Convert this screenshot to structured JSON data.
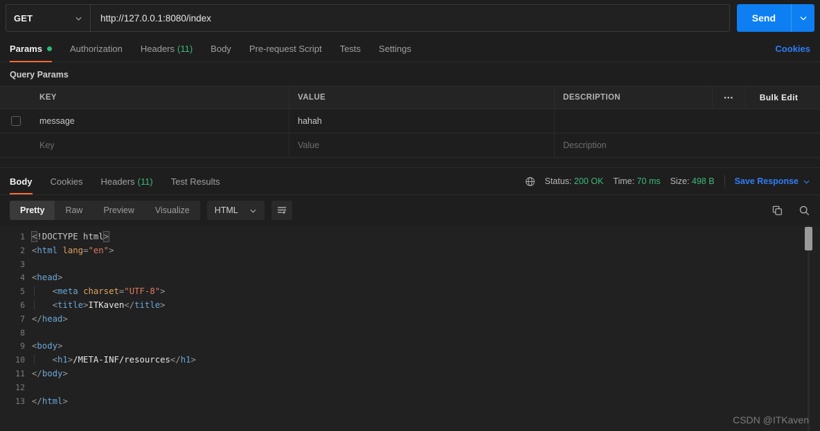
{
  "request": {
    "method": "GET",
    "url": "http://127.0.0.1:8080/index",
    "send_label": "Send",
    "tabs": [
      {
        "label": "Params",
        "badge": "",
        "dot": true,
        "active": true
      },
      {
        "label": "Authorization",
        "badge": "",
        "dot": false,
        "active": false
      },
      {
        "label": "Headers",
        "badge": "(11)",
        "dot": false,
        "active": false
      },
      {
        "label": "Body",
        "badge": "",
        "dot": false,
        "active": false
      },
      {
        "label": "Pre-request Script",
        "badge": "",
        "dot": false,
        "active": false
      },
      {
        "label": "Tests",
        "badge": "",
        "dot": false,
        "active": false
      },
      {
        "label": "Settings",
        "badge": "",
        "dot": false,
        "active": false
      }
    ],
    "cookies_link": "Cookies"
  },
  "query_params": {
    "section_title": "Query Params",
    "columns": {
      "key": "KEY",
      "value": "VALUE",
      "description": "DESCRIPTION"
    },
    "more_icon": "•••",
    "bulk_edit": "Bulk Edit",
    "rows": [
      {
        "checked": false,
        "key": "message",
        "value": "hahah",
        "description": "",
        "placeholder": false
      },
      {
        "checked": null,
        "key": "Key",
        "value": "Value",
        "description": "Description",
        "placeholder": true
      }
    ]
  },
  "response": {
    "tabs": [
      {
        "label": "Body",
        "badge": "",
        "active": true
      },
      {
        "label": "Cookies",
        "badge": "",
        "active": false
      },
      {
        "label": "Headers",
        "badge": "(11)",
        "active": false
      },
      {
        "label": "Test Results",
        "badge": "",
        "active": false
      }
    ],
    "status_label": "Status:",
    "status_value": "200 OK",
    "time_label": "Time:",
    "time_value": "70 ms",
    "size_label": "Size:",
    "size_value": "498 B",
    "save_response": "Save Response",
    "view_modes": [
      {
        "label": "Pretty",
        "active": true
      },
      {
        "label": "Raw",
        "active": false
      },
      {
        "label": "Preview",
        "active": false
      },
      {
        "label": "Visualize",
        "active": false
      }
    ],
    "format": "HTML",
    "body_lines": [
      {
        "n": "1",
        "html": "<span class=\"tk-punct sel-box\">&lt;</span><span class=\"tk-doct\">!DOCTYPE html</span><span class=\"tk-punct sel-box\">&gt;</span>"
      },
      {
        "n": "2",
        "html": "<span class=\"tk-punct\">&lt;</span><span class=\"tk-tag\">html</span> <span class=\"tk-attr\">lang</span><span class=\"tk-punct\">=</span><span class=\"tk-str\">\"en\"</span><span class=\"tk-punct\">&gt;</span>"
      },
      {
        "n": "3",
        "html": ""
      },
      {
        "n": "4",
        "html": "<span class=\"tk-punct\">&lt;</span><span class=\"tk-tag\">head</span><span class=\"tk-punct\">&gt;</span>"
      },
      {
        "n": "5",
        "html": "<span class=\"indent-guide\">│</span>   <span class=\"tk-punct\">&lt;</span><span class=\"tk-tag\">meta</span> <span class=\"tk-attr\">charset</span><span class=\"tk-punct\">=</span><span class=\"tk-str\">\"UTF-8\"</span><span class=\"tk-punct\">&gt;</span>"
      },
      {
        "n": "6",
        "html": "<span class=\"indent-guide\">│</span>   <span class=\"tk-punct\">&lt;</span><span class=\"tk-tag\">title</span><span class=\"tk-punct\">&gt;</span><span class=\"tk-text\">ITKaven</span><span class=\"tk-punct\">&lt;/</span><span class=\"tk-tag\">title</span><span class=\"tk-punct\">&gt;</span>"
      },
      {
        "n": "7",
        "html": "<span class=\"tk-punct\">&lt;/</span><span class=\"tk-tag\">head</span><span class=\"tk-punct\">&gt;</span>"
      },
      {
        "n": "8",
        "html": ""
      },
      {
        "n": "9",
        "html": "<span class=\"tk-punct\">&lt;</span><span class=\"tk-tag\">body</span><span class=\"tk-punct\">&gt;</span>"
      },
      {
        "n": "10",
        "html": "<span class=\"indent-guide\">│</span>   <span class=\"tk-punct\">&lt;</span><span class=\"tk-tag\">h1</span><span class=\"tk-punct\">&gt;</span><span class=\"tk-text\">/META-INF/resources</span><span class=\"tk-punct\">&lt;/</span><span class=\"tk-tag\">h1</span><span class=\"tk-punct\">&gt;</span>"
      },
      {
        "n": "11",
        "html": "<span class=\"tk-punct\">&lt;/</span><span class=\"tk-tag\">body</span><span class=\"tk-punct\">&gt;</span>"
      },
      {
        "n": "12",
        "html": ""
      },
      {
        "n": "13",
        "html": "<span class=\"tk-punct\">&lt;/</span><span class=\"tk-tag\">html</span><span class=\"tk-punct\">&gt;</span>"
      }
    ],
    "body_text": "<!DOCTYPE html>\n<html lang=\"en\">\n\n<head>\n    <meta charset=\"UTF-8\">\n    <title>ITKaven</title>\n</head>\n\n<body>\n    <h1>/META-INF/resources</h1>\n</body>\n\n</html>"
  },
  "watermark": "CSDN @ITKaven",
  "colors": {
    "accent_orange": "#ff6c37",
    "link_blue": "#2f7df6",
    "send_blue": "#0d7ff2",
    "status_green": "#3db97a",
    "background": "#1e1e1e",
    "editor_background": "#212121"
  }
}
